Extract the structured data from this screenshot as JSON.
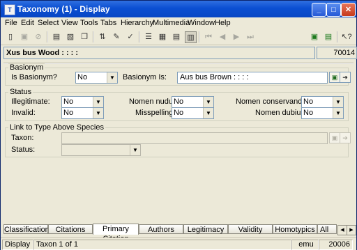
{
  "window": {
    "title": "Taxonomy (1) - Display",
    "app_icon": "T",
    "min": "_",
    "max": "□",
    "close": "✕"
  },
  "menu": [
    "File",
    "Edit",
    "Select",
    "View",
    "Tools",
    "Tabs",
    "Hierarchy",
    "Multimedia",
    "Window",
    "Help"
  ],
  "toolbar_icons": [
    "new-icon",
    "save-icon",
    "cancel-icon",
    "add-record-icon",
    "delete-record-icon",
    "copy-record-icon",
    "sort-icon",
    "edit-icon",
    "spellcheck-icon",
    "list-view-icon",
    "grid-view-icon",
    "table-view-icon",
    "details-view-icon",
    "first-icon",
    "prev-icon",
    "next-icon",
    "last-icon",
    "attach-icon",
    "attach-multi-icon",
    "help-icon"
  ],
  "record": {
    "title": "Xus bus Wood : : : :",
    "id": "70014"
  },
  "basionym": {
    "group_title": "Basionym",
    "is_basionym_label": "Is Basionym?",
    "is_basionym_value": "No",
    "basionym_is_label": "Basionym Is:",
    "basionym_is_value": "Aus bus Brown : : : :"
  },
  "status": {
    "group_title": "Status",
    "illegitimate_label": "Illegitimate:",
    "illegitimate_value": "No",
    "invalid_label": "Invalid:",
    "invalid_value": "No",
    "nomen_nudum_label": "Nomen nudum:",
    "nomen_nudum_value": "No",
    "misspelling_label": "Misspelling:",
    "misspelling_value": "No",
    "nomen_conservandum_label": "Nomen conservandum:",
    "nomen_conservandum_value": "No",
    "nomen_dubium_label": "Nomen dubium:",
    "nomen_dubium_value": "No"
  },
  "link": {
    "group_title": "Link to Type Above Species",
    "taxon_label": "Taxon:",
    "taxon_value": "",
    "status_label": "Status:",
    "status_value": ""
  },
  "tabs": [
    "Classification",
    "Citations",
    "Primary Citation",
    "Authors",
    "Legitimacy",
    "Validity",
    "Homotypics",
    "All Sy"
  ],
  "active_tab": "Primary Citation",
  "statusbar": {
    "mode": "Display",
    "position": "Taxon 1 of 1",
    "user": "emu",
    "number": "20006"
  }
}
